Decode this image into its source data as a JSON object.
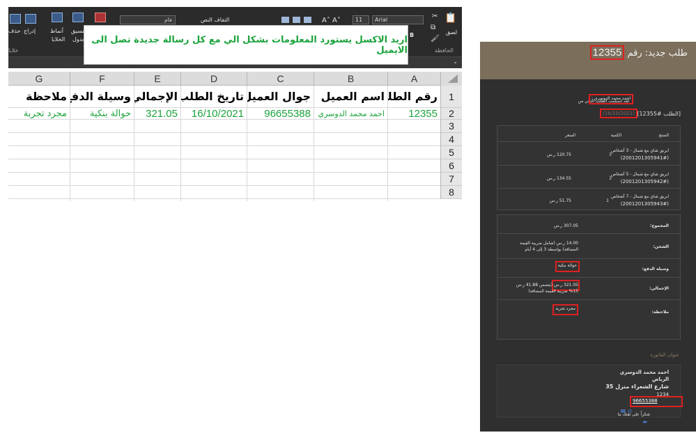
{
  "ribbon": {
    "font_name": "Arial",
    "font_size": "11",
    "number_format": "عام",
    "insert_label": "إدراج",
    "delete_label": "حذف",
    "format_label": "تنسيق",
    "styles_label": "أنماط",
    "table_label": "جدول",
    "cells_label": "الخلايا",
    "paste_label": "لصق",
    "clipboard_label": "الحافظة",
    "wrap_label": "التفاف النص",
    "cells_group_label": "خلايا"
  },
  "callout": {
    "text": "اريد الاكسل يستورد المعلومات بشكل الي مع كل رسالة جديدة تصل الى الايميل"
  },
  "sheet": {
    "columns": [
      "A",
      "B",
      "C",
      "D",
      "E",
      "F",
      "G"
    ],
    "rows": [
      "1",
      "2",
      "3",
      "4",
      "5",
      "6",
      "7",
      "8"
    ],
    "headers": [
      "رقم الطلب",
      "اسم العميل",
      "جوال العميل",
      "تاريخ الطلب",
      "الإجمالي",
      "وسيلة الدفع",
      "ملاحظة"
    ],
    "record": [
      "12355",
      "احمد محمد الدوسري",
      "96655388",
      "16/10/2021",
      "321.05",
      "حوالة بنكية",
      "مجرد تجربة"
    ]
  },
  "email": {
    "title_prefix": "طلب جديد: رقم",
    "order_number": "12355",
    "received_from": "لقد استلمت الطلب التالي من",
    "customer": "احمد محمد الدوسري :",
    "order_ref": "[الطلب #12355]",
    "order_date": "(16/10/2021)",
    "table_headers": {
      "product": "المنتج",
      "qty": "الكمية",
      "price": "السعر"
    },
    "items": [
      {
        "name": "ابريق شاي مع شمال - 3 أشخاص",
        "sku": "(2001201305941#)",
        "qty": "3",
        "price": "120.75 ر.س"
      },
      {
        "name": "ابريق شاي مع شمال - 5 أشخاص",
        "sku": "(2001201305942#)",
        "qty": "3",
        "price": "134.55 ر.س"
      },
      {
        "name": "ابريق شاي مع شمال - 7 أشخاص",
        "sku": "(2001201305943#)",
        "qty": "1",
        "price": "51.75 ر.س"
      }
    ],
    "subtotal_label": "المجموع:",
    "subtotal_value": "307.05 ر.س",
    "shipping_label": "الشحن:",
    "shipping_value": "14.00 ر.س (شامل ضريبة القيمة المضافة) بواسطة 3 إلى 4 أيام",
    "payment_label": "وسيلة الدفع:",
    "payment_value": "حوالة بنكية",
    "total_label": "الإجمالي:",
    "total_value": "321.05 ر.س (يتضمن 41.88 ر.س 15% ضريبة القيمة المضافة)",
    "note_label": "ملاحظة:",
    "note_value": "مجرد تجربة",
    "billing_title": "عنوان الفاتورة",
    "billing_name": "احمد محمد الدوسري",
    "billing_city": "الرياض",
    "billing_street": "شارع الشعراء منزل 35",
    "billing_zip": "1234",
    "billing_phone": "96655388",
    "footer": "شكراً على ثقتك بنا"
  }
}
